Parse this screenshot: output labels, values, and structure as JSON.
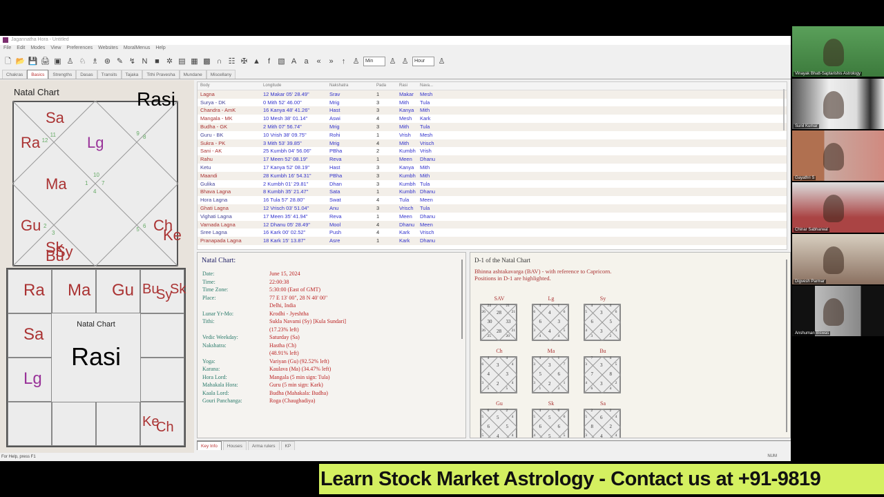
{
  "window": {
    "title": "Jagannatha Hora - Untitled",
    "status": "For Help, press F1",
    "num": "NUM"
  },
  "menu": [
    "File",
    "Edit",
    "Modes",
    "View",
    "Preferences",
    "Websites",
    "MoralMenus",
    "Help"
  ],
  "toolbar": {
    "select1": "Min",
    "select2": "Hour"
  },
  "tabs": [
    {
      "label": "Chakras"
    },
    {
      "label": "Basics",
      "active": true
    },
    {
      "label": "Strengths"
    },
    {
      "label": "Dasas"
    },
    {
      "label": "Transits"
    },
    {
      "label": "Tajaka"
    },
    {
      "label": "Tithi Pravesha"
    },
    {
      "label": "Mundane"
    },
    {
      "label": "Miscellany"
    }
  ],
  "north_chart": {
    "title": "Natal Chart",
    "name": "Rasi",
    "houses": [
      {
        "sign": "10",
        "planets": [
          "Lg"
        ]
      },
      {
        "sign": "11",
        "planets": [
          "Sa"
        ]
      },
      {
        "sign": "12",
        "planets": [
          "Ra"
        ]
      },
      {
        "sign": "1",
        "planets": [
          "Ma"
        ]
      },
      {
        "sign": "2",
        "planets": [
          "Gu"
        ]
      },
      {
        "sign": "3",
        "planets": [
          "Sk",
          "Sy",
          "Bu"
        ]
      },
      {
        "sign": "4",
        "planets": []
      },
      {
        "sign": "5",
        "planets": []
      },
      {
        "sign": "6",
        "planets": [
          "Ch",
          "Ke"
        ]
      },
      {
        "sign": "7",
        "planets": []
      },
      {
        "sign": "8",
        "planets": []
      },
      {
        "sign": "9",
        "planets": []
      }
    ]
  },
  "south_chart": {
    "title": "Natal Chart",
    "name": "Rasi",
    "cells": {
      "Meen": [
        "Ra"
      ],
      "Mesh": [
        "Ma"
      ],
      "Vrish": [
        "Gu"
      ],
      "Mith": [
        "Bu",
        "Sy",
        "Sk"
      ],
      "Kumbh": [
        "Sa"
      ],
      "Makar": [
        "Lg"
      ],
      "Kanya": [
        "Ke",
        "Ch"
      ]
    }
  },
  "table": {
    "headers": [
      "Body",
      "Longitude",
      "Nakshatra",
      "Pada",
      "Rasi",
      "Nava..."
    ],
    "rows": [
      [
        "Lagna",
        "12 Makar 05' 28.49\"",
        "Srav",
        "1",
        "Makar",
        "Mesh"
      ],
      [
        "Surya - DK",
        "0 Mith 52' 46.00\"",
        "Mrig",
        "3",
        "Mith",
        "Tula"
      ],
      [
        "Chandra - AmK",
        "16 Kanya 48' 41.26\"",
        "Hast",
        "3",
        "Kanya",
        "Mith"
      ],
      [
        "Mangala - MK",
        "10 Mesh 38' 01.14\"",
        "Aswi",
        "4",
        "Mesh",
        "Kark"
      ],
      [
        "Budha - GK",
        "2 Mith 07' 56.74\"",
        "Mrig",
        "3",
        "Mith",
        "Tula"
      ],
      [
        "Guru - BK",
        "10 Vrish 38' 09.75\"",
        "Rohi",
        "1",
        "Vrish",
        "Mesh"
      ],
      [
        "Sukra - PK",
        "3 Mith 53' 39.85\"",
        "Mrig",
        "4",
        "Mith",
        "Vrisch"
      ],
      [
        "Sani - AK",
        "25 Kumbh 04' 56.06\"",
        "PBha",
        "2",
        "Kumbh",
        "Vrish"
      ],
      [
        "Rahu",
        "17 Meen 52' 08.19\"",
        "Reva",
        "1",
        "Meen",
        "Dhanu"
      ],
      [
        "Ketu",
        "17 Kanya 52' 08.19\"",
        "Hast",
        "3",
        "Kanya",
        "Mith"
      ],
      [
        "Maandi",
        "28 Kumbh 16' 54.31\"",
        "PBha",
        "3",
        "Kumbh",
        "Mith"
      ],
      [
        "Gulika",
        "2 Kumbh 01' 29.81\"",
        "Dhan",
        "3",
        "Kumbh",
        "Tula"
      ],
      [
        "Bhava Lagna",
        "8 Kumbh 35' 21.47\"",
        "Sata",
        "1",
        "Kumbh",
        "Dhanu"
      ],
      [
        "Hora Lagna",
        "16 Tula 57' 28.80\"",
        "Swat",
        "4",
        "Tula",
        "Meen"
      ],
      [
        "Ghati Lagna",
        "12 Vrisch 03' 51.04\"",
        "Anu",
        "3",
        "Vrisch",
        "Tula"
      ],
      [
        "Vighati Lagna",
        "17 Meen 35' 41.94\"",
        "Reva",
        "1",
        "Meen",
        "Dhanu"
      ],
      [
        "Varnada Lagna",
        "12 Dhanu 05' 28.49\"",
        "Mool",
        "4",
        "Dhanu",
        "Meen"
      ],
      [
        "Sree Lagna",
        "16 Kark 00' 02.52\"",
        "Push",
        "4",
        "Kark",
        "Vrisch"
      ],
      [
        "Pranapada Lagna",
        "18 Kark 15' 13.87\"",
        "Asre",
        "1",
        "Kark",
        "Dhanu"
      ]
    ]
  },
  "info": {
    "title": "Natal Chart:",
    "rows": [
      [
        "Date:",
        "June 15, 2024"
      ],
      [
        "Time:",
        "22:00:38"
      ],
      [
        "Time Zone:",
        "5:30:00 (East of GMT)"
      ],
      [
        "Place:",
        "77 E 13' 00\", 28 N 40' 00\""
      ],
      [
        "",
        "Delhi, India"
      ],
      [
        "",
        ""
      ],
      [
        "Lunar Yr-Mo:",
        "Krodhi - Jyeshtha"
      ],
      [
        "Tithi:",
        "Sukla Navami (Sy) [Kula Sundari]"
      ],
      [
        "",
        "(17.23% left)"
      ],
      [
        "Vedic Weekday:",
        "Saturday (Sa)"
      ],
      [
        "Nakshatra:",
        "Hastha (Ch)"
      ],
      [
        "",
        "(48.91% left)"
      ],
      [
        "Yoga:",
        "Variyan (Gu) (92.52% left)"
      ],
      [
        "Karana:",
        "Kaulava (Ma) (34.47% left)"
      ],
      [
        "Hora Lord:",
        "Mangala (5 min sign: Tula)"
      ],
      [
        "Mahakala Hora:",
        "Guru (5 min sign: Kark)"
      ],
      [
        "Kaala Lord:",
        "Budha (Mahakala: Budha)"
      ],
      [
        "Gouri Panchanga:",
        "Roga (Chaughadiya)"
      ]
    ]
  },
  "bav": {
    "title": "D-1 of the Natal Chart",
    "desc1": "Bhinna ashtakavarga (BAV) - with reference to Capricorn.",
    "desc2": "Positions in D-1 are highlighted.",
    "charts": [
      {
        "label": "SAV",
        "values": [
          28,
          24,
          26,
          30,
          26,
          25,
          28,
          20,
          21,
          33,
          21,
          21
        ]
      },
      {
        "label": "Lg",
        "values": [
          4,
          4,
          6,
          6,
          3,
          4,
          4,
          4,
          5,
          3,
          6,
          1
        ]
      },
      {
        "label": "Sy",
        "values": [
          3,
          4,
          5,
          6,
          4,
          3,
          3,
          2,
          3,
          5,
          6,
          4
        ]
      },
      {
        "label": "Ch",
        "values": [
          3,
          4,
          6,
          4,
          3,
          5,
          2,
          5,
          4,
          3,
          4,
          4
        ]
      },
      {
        "label": "Ma",
        "values": [
          3,
          4,
          3,
          5,
          3,
          1,
          2,
          3,
          1,
          6,
          7,
          1
        ]
      },
      {
        "label": "Bu",
        "values": [
          3,
          7,
          3,
          7,
          4,
          6,
          3,
          4,
          2,
          8,
          5,
          4
        ]
      },
      {
        "label": "Gu",
        "values": [
          5,
          6,
          5,
          6,
          5,
          5,
          4,
          4,
          4,
          5,
          4,
          2
        ]
      },
      {
        "label": "Sk",
        "values": [
          5,
          4,
          5,
          6,
          4,
          4,
          5,
          4,
          5,
          6,
          6,
          6
        ]
      },
      {
        "label": "Sa",
        "values": [
          6,
          2,
          5,
          8,
          3,
          3,
          4,
          3,
          4,
          2,
          4,
          2
        ]
      }
    ]
  },
  "bottom_tabs": [
    {
      "label": "Key Info",
      "active": true
    },
    {
      "label": "Houses"
    },
    {
      "label": "Arma rulers"
    },
    {
      "label": "KP"
    }
  ],
  "participants": [
    "Vinayak Bhatt-Saptarishis Astrology",
    "Sunil Kumar",
    "Gayathri S",
    "Chinar Sabharwal",
    "Digvesh Parmar",
    "Anshuman Biswas"
  ],
  "banner": "Learn Stock Market Astrology - Contact us at +91-9819",
  "colors": {
    "planet": "#aa3333",
    "lagna": "#993399",
    "banner_bg": "#d4f060",
    "header_text": "#2a7a6a"
  }
}
